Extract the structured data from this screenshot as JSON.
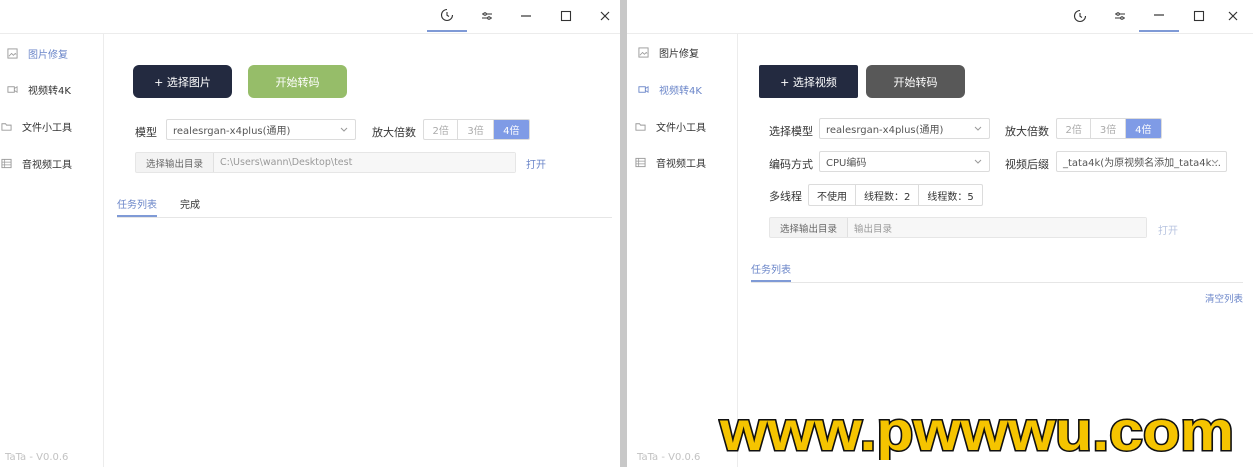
{
  "colors": {
    "accent": "#7f9be6",
    "dark_button": "#232a40",
    "green_button": "#96bd69",
    "gray_button": "#585858"
  },
  "left": {
    "sidebar": {
      "items": [
        {
          "label": "图片修复",
          "icon": "image-icon",
          "active": true
        },
        {
          "label": "视频转4K",
          "icon": "video-icon",
          "active": false
        },
        {
          "label": "文件小工具",
          "icon": "folder-icon",
          "active": false
        },
        {
          "label": "音视频工具",
          "icon": "media-icon",
          "active": false
        }
      ],
      "version": "TaTa - V0.0.6"
    },
    "buttons": {
      "select": "+ 选择图片",
      "start": "开始转码"
    },
    "model_label": "模型",
    "model_value": "realesrgan-x4plus(通用)",
    "scale_label": "放大倍数",
    "scale_options": [
      "2倍",
      "3倍",
      "4倍"
    ],
    "scale_selected": "4倍",
    "output": {
      "button": "选择输出目录",
      "path": "C:\\Users\\wann\\Desktop\\test",
      "open": "打开"
    },
    "tabs": [
      "任务列表",
      "完成"
    ]
  },
  "right": {
    "sidebar": {
      "items": [
        {
          "label": "图片修复",
          "icon": "image-icon",
          "active": false
        },
        {
          "label": "视频转4K",
          "icon": "video-icon",
          "active": true
        },
        {
          "label": "文件小工具",
          "icon": "folder-icon",
          "active": false
        },
        {
          "label": "音视频工具",
          "icon": "media-icon",
          "active": false
        }
      ],
      "version": "TaTa - V0.0.6"
    },
    "buttons": {
      "select": "+ 选择视频",
      "start": "开始转码"
    },
    "model_label": "选择模型",
    "model_value": "realesrgan-x4plus(通用)",
    "scale_label": "放大倍数",
    "scale_options": [
      "2倍",
      "3倍",
      "4倍"
    ],
    "scale_selected": "4倍",
    "encode_label": "编码方式",
    "encode_value": "CPU编码",
    "suffix_label": "视频后缀",
    "suffix_value": "_tata4k(为原视频名添加_tata4k...",
    "threads_label": "多线程",
    "thread_options": [
      "不使用",
      "线程数：2",
      "线程数：5"
    ],
    "output": {
      "button": "选择输出目录",
      "placeholder": "输出目录",
      "open": "打开"
    },
    "tabs": [
      "任务列表"
    ],
    "clear": "清空列表"
  },
  "watermark": "www.pwwwu.com"
}
